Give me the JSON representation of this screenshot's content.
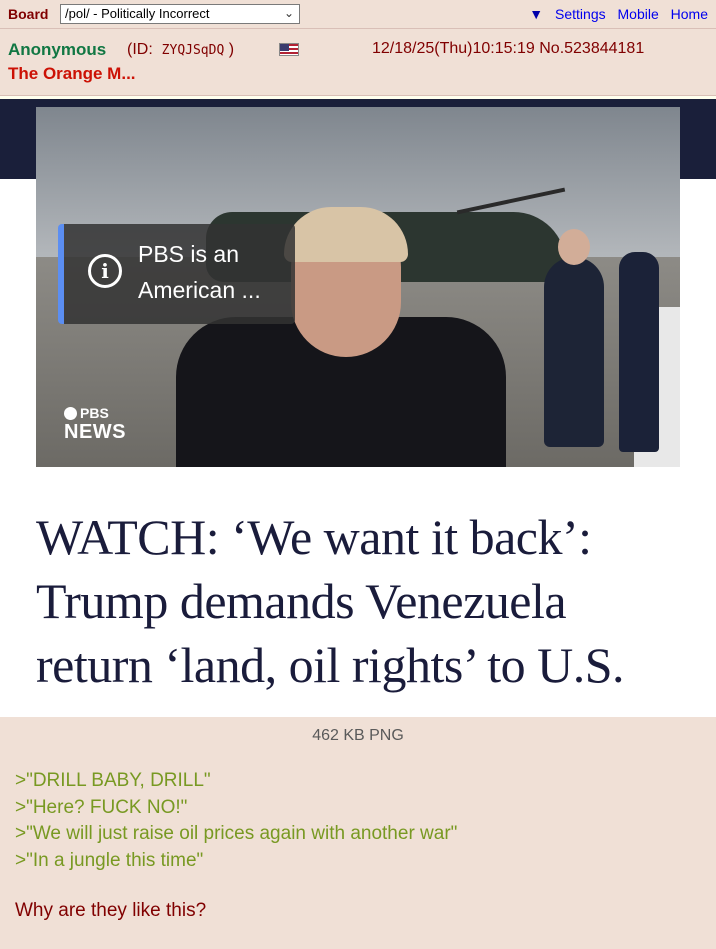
{
  "nav": {
    "board_label": "Board",
    "board_select": "/pol/ - Politically Incorrect",
    "settings_marker": "▼",
    "settings": "Settings",
    "mobile": "Mobile",
    "home": "Home"
  },
  "post": {
    "name": "Anonymous",
    "id_prefix": "(ID:",
    "id_value": "ZYQJSqDQ",
    "id_suffix": ")",
    "flag": "us-flag-icon",
    "date": "12/18/25(Thu)10:15:19 No.523844181",
    "subject": "The Orange M...",
    "file_info": "462 KB PNG",
    "greentext": [
      ">\"DRILL BABY, DRILL\"",
      ">\"Here? FUCK NO!\"",
      ">\"We will just raise oil prices again with another war\"",
      ">\"In a jungle this time\""
    ],
    "comment": "Why are they like this?"
  },
  "image": {
    "info_text": "PBS is an American ...",
    "logo_top": "PBS",
    "logo_bottom": "NEWS",
    "headline": "WATCH: ‘We want it back’: Trump demands Venezuela return ‘land, oil rights’ to U.S."
  },
  "colors": {
    "post_bg": "#f0e0d6",
    "name": "#117743",
    "subject": "#cc1105",
    "greentext": "#789922",
    "text": "#800000",
    "headline": "#1a1c3b"
  }
}
